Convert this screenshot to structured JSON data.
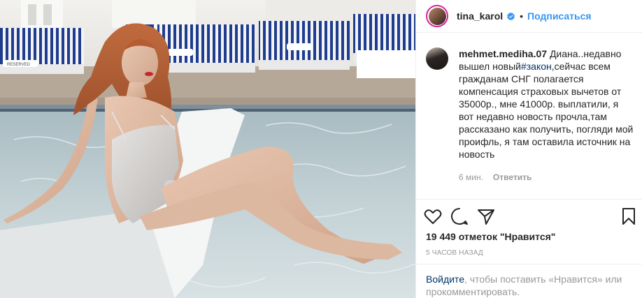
{
  "photo": {
    "caption_sign": "RESERVED"
  },
  "header": {
    "username": "tina_karol",
    "separator": "•",
    "follow_label": "Подписаться",
    "verified_icon": "verified-badge-icon"
  },
  "comment": {
    "username": "mehmet.mediha.07",
    "text_before_tag": "Диана..недавно вышел новый",
    "hashtag": "#закон",
    "text_after_tag": ",сейчас всем гражданам СНГ полагается компенсация страховых вычетов от 35000р., мне 41000р. выплатили, я вот недавно новость прочла,там рассказано как получить, погляди мой проифль, я там оставила источник на новость",
    "time": "6 мин.",
    "reply_label": "Ответить"
  },
  "actions": {
    "like_icon": "heart-icon",
    "comment_icon": "comment-bubble-icon",
    "share_icon": "paper-plane-icon",
    "save_icon": "bookmark-icon"
  },
  "likes": "19 449 отметок \"Нравится\"",
  "timeago": "5 часов назад",
  "login": {
    "link": "Войдите",
    "text": ", чтобы поставить «Нравится» или прокомментировать."
  },
  "colors": {
    "link_blue": "#3897f0",
    "text_dark": "#262626",
    "muted": "#999999",
    "hashtag": "#003569",
    "divider": "#efefef"
  }
}
